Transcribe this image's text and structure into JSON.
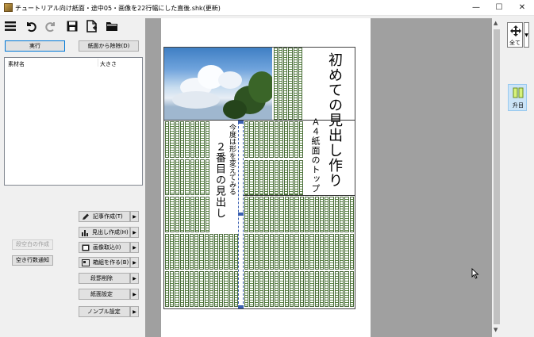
{
  "window": {
    "title": "チュートリアル向け紙面・途中05・画像を22行幅にした直後.shk(更新)",
    "minimize": "—",
    "maximize": "☐",
    "close": "✕"
  },
  "toolbar": {
    "icons": [
      "menu-icon",
      "undo-icon",
      "redo-icon",
      "save-icon",
      "new-file-icon",
      "folder-icon"
    ]
  },
  "left": {
    "run_label": "実行",
    "remove_label": "紙面から除除(D)",
    "list_columns": [
      "素材名",
      "大きさ"
    ],
    "actions": [
      {
        "label": "記事作成(T)",
        "icon": "pencil-icon"
      },
      {
        "label": "見出し作成(H)",
        "icon": "headline-icon"
      },
      {
        "label": "画像取込(I)",
        "icon": "image-icon"
      },
      {
        "label": "箱組を作る(B)",
        "icon": "box-icon"
      },
      {
        "label": "段罫削除",
        "icon": ""
      },
      {
        "label": "紙面設定",
        "icon": ""
      },
      {
        "label": "ノンブル設定",
        "icon": ""
      }
    ],
    "blank_create_label": "段空白の作成",
    "blank_count_label": "空き行数通知"
  },
  "document": {
    "headline_main": "初めての見出し作り",
    "headline_sub": "Ａ４紙面のトップ",
    "headline2_main": "２番目の見出し",
    "headline2_sub": "今度は形を変えてみる"
  },
  "rightpanel": {
    "all_label": "全て",
    "column_label": "升目"
  },
  "colors": {
    "accent": "#0078d7",
    "text_line": "#5c8a45"
  }
}
